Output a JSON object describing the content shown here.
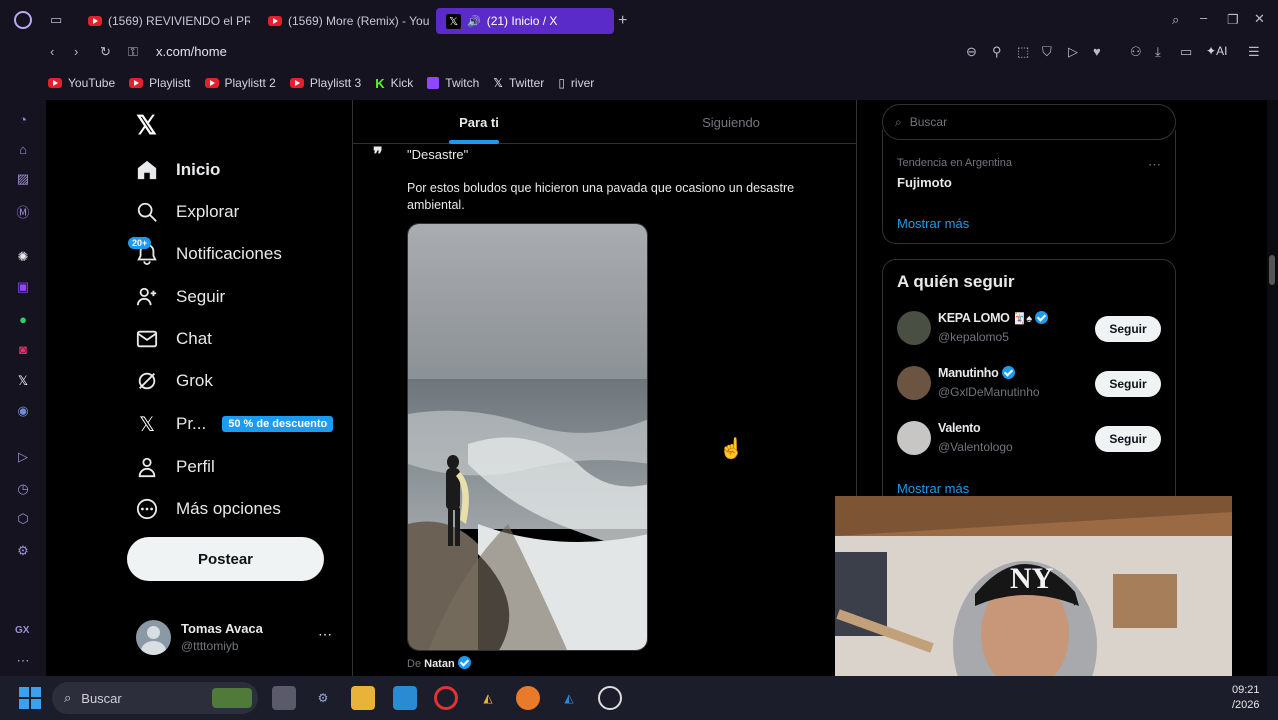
{
  "browser": {
    "tabs": [
      {
        "label": "(1569) REVIVIENDO el PRI",
        "type": "youtube"
      },
      {
        "label": "(1569) More (Remix) - You",
        "type": "youtube"
      },
      {
        "label": "(21) Inicio / X",
        "type": "x",
        "active": true
      }
    ],
    "url": "x.com/home",
    "ai_label": "AI",
    "bookmarks": [
      {
        "label": "YouTube",
        "icon": "youtube-icon"
      },
      {
        "label": "Playlistt",
        "icon": "youtube-icon"
      },
      {
        "label": "Playlistt 2",
        "icon": "youtube-icon"
      },
      {
        "label": "Playlistt 3",
        "icon": "youtube-icon"
      },
      {
        "label": "Kick",
        "icon": "kick-icon"
      },
      {
        "label": "Twitch",
        "icon": "twitch-icon"
      },
      {
        "label": "Twitter",
        "icon": "x-icon"
      },
      {
        "label": "river",
        "icon": "document-icon"
      }
    ],
    "sidebar_bottom_label": "GX"
  },
  "x_nav": {
    "items": [
      {
        "label": "Inicio",
        "icon": "home-icon",
        "active": true
      },
      {
        "label": "Explorar",
        "icon": "search-icon"
      },
      {
        "label": "Notificaciones",
        "icon": "bell-icon",
        "badge": "20+"
      },
      {
        "label": "Seguir",
        "icon": "add-person-icon"
      },
      {
        "label": "Chat",
        "icon": "mail-icon"
      },
      {
        "label": "Grok",
        "icon": "grok-icon"
      },
      {
        "label": "Pr...",
        "icon": "x-icon",
        "badge": "50 % de descuento"
      },
      {
        "label": "Perfil",
        "icon": "person-icon"
      },
      {
        "label": "Más opciones",
        "icon": "more-circle-icon"
      }
    ],
    "post_button": "Postear",
    "account": {
      "name": "Tomas Avaca",
      "handle": "@ttttomiyb"
    }
  },
  "feed": {
    "tabs": [
      {
        "label": "Para ti",
        "active": true
      },
      {
        "label": "Siguiendo",
        "active": false
      }
    ],
    "post": {
      "quote": "\"Desastre\"",
      "text": "Por estos boludos que hicieron una pavada que ocasiono un desastre ambiental.",
      "footer_prefix": "De",
      "footer_name": "Natan"
    }
  },
  "sidebar_right": {
    "search_placeholder": "Buscar",
    "trend_context": "Tendencia en Argentina",
    "trend_name": "Fujimoto",
    "show_more": "Mostrar más",
    "who_to_follow_title": "A quién seguir",
    "follow_label": "Seguir",
    "suggestions": [
      {
        "name": "KEPA LOMO",
        "handle": "@kepalomo5",
        "verified": true
      },
      {
        "name": "Manutinho",
        "handle": "@GxlDeManutinho",
        "verified": true
      },
      {
        "name": "Valento",
        "handle": "@Valentologo",
        "verified": false
      }
    ],
    "show_more_2": "Mostrar más"
  },
  "taskbar": {
    "search_label": "Buscar",
    "time": "09:21",
    "date_fragment": "/2026"
  },
  "colors": {
    "accent_blue": "#1d9bf0",
    "opera_purple": "#5b2bc9",
    "chrome_bg": "#161321"
  }
}
